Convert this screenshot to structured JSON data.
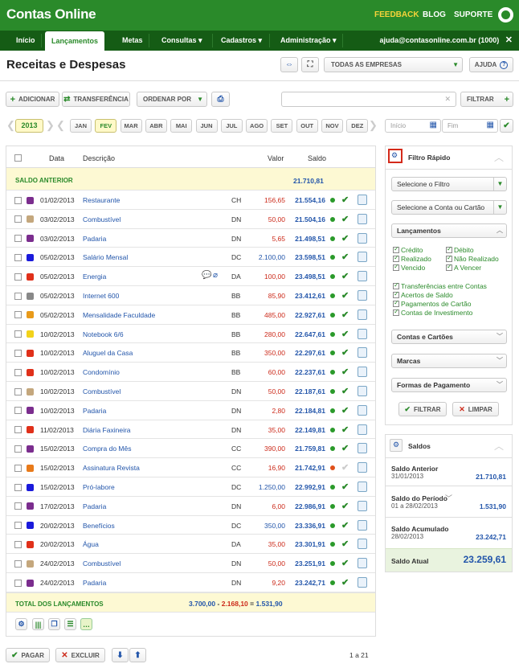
{
  "header": {
    "logo": "Contas Online",
    "links": [
      "FEEDBACK",
      "BLOG",
      "SUPORTE"
    ]
  },
  "nav": {
    "items": [
      "Início",
      "Lançamentos",
      "Metas",
      "Consultas ▾",
      "Cadastros ▾",
      "Administração ▾"
    ],
    "user": "ajuda@contasonline.com.br (1000)",
    "close": "✕"
  },
  "page": {
    "title": "Receitas e Despesas",
    "company_select": "TODAS AS EMPRESAS",
    "help": "AJUDA"
  },
  "toolbar": {
    "add": "ADICIONAR",
    "transfer": "TRANSFERÊNCIA",
    "order": "ORDENAR POR",
    "filter": "FILTRAR",
    "search_placeholder": ""
  },
  "months": {
    "year": "2013",
    "list": [
      "JAN",
      "FEV",
      "MAR",
      "ABR",
      "MAI",
      "JUN",
      "JUL",
      "AGO",
      "SET",
      "OUT",
      "NOV",
      "DEZ"
    ],
    "selected": "FEV",
    "start_placeholder": "Início",
    "end_placeholder": "Fim"
  },
  "table": {
    "headers": {
      "date": "Data",
      "desc": "Descrição",
      "value": "Valor",
      "balance": "Saldo"
    },
    "prev_balance_label": "SALDO ANTERIOR",
    "prev_balance": "21.710,81",
    "rows": [
      {
        "date": "01/02/2013",
        "desc": "Restaurante",
        "type": "CH",
        "value": "156,65",
        "balance": "21.554,16",
        "cat": "#7b2d8e",
        "kind": "exp",
        "status": "green",
        "ok": true
      },
      {
        "date": "03/02/2013",
        "desc": "Combustível",
        "type": "DN",
        "value": "50,00",
        "balance": "21.504,16",
        "cat": "#c4a77d",
        "kind": "exp",
        "status": "green",
        "ok": true
      },
      {
        "date": "03/02/2013",
        "desc": "Padaria",
        "type": "DN",
        "value": "5,65",
        "balance": "21.498,51",
        "cat": "#7b2d8e",
        "kind": "exp",
        "status": "green",
        "ok": true
      },
      {
        "date": "05/02/2013",
        "desc": "Salário Mensal",
        "type": "DC",
        "value": "2.100,00",
        "balance": "23.598,51",
        "cat": "#1a1adb",
        "kind": "inc",
        "status": "green",
        "ok": true
      },
      {
        "date": "05/02/2013",
        "desc": "Energia",
        "type": "DA",
        "value": "100,00",
        "balance": "23.498,51",
        "cat": "#e0301a",
        "kind": "exp",
        "status": "green",
        "ok": true,
        "extra": true
      },
      {
        "date": "05/02/2013",
        "desc": "Internet 600",
        "type": "BB",
        "value": "85,90",
        "balance": "23.412,61",
        "cat": "#888888",
        "kind": "exp",
        "status": "green",
        "ok": true
      },
      {
        "date": "05/02/2013",
        "desc": "Mensalidade Faculdade",
        "type": "BB",
        "value": "485,00",
        "balance": "22.927,61",
        "cat": "#e89a1a",
        "kind": "exp",
        "status": "green",
        "ok": true
      },
      {
        "date": "10/02/2013",
        "desc": "Notebook 6/6",
        "type": "BB",
        "value": "280,00",
        "balance": "22.647,61",
        "cat": "#f2d21a",
        "kind": "exp",
        "status": "green",
        "ok": true
      },
      {
        "date": "10/02/2013",
        "desc": "Aluguel da Casa",
        "type": "BB",
        "value": "350,00",
        "balance": "22.297,61",
        "cat": "#e0301a",
        "kind": "exp",
        "status": "green",
        "ok": true
      },
      {
        "date": "10/02/2013",
        "desc": "Condomínio",
        "type": "BB",
        "value": "60,00",
        "balance": "22.237,61",
        "cat": "#e0301a",
        "kind": "exp",
        "status": "green",
        "ok": true
      },
      {
        "date": "10/02/2013",
        "desc": "Combustível",
        "type": "DN",
        "value": "50,00",
        "balance": "22.187,61",
        "cat": "#c4a77d",
        "kind": "exp",
        "status": "green",
        "ok": true
      },
      {
        "date": "10/02/2013",
        "desc": "Padaria",
        "type": "DN",
        "value": "2,80",
        "balance": "22.184,81",
        "cat": "#7b2d8e",
        "kind": "exp",
        "status": "green",
        "ok": true
      },
      {
        "date": "11/02/2013",
        "desc": "Diária Faxineira",
        "type": "DN",
        "value": "35,00",
        "balance": "22.149,81",
        "cat": "#e0301a",
        "kind": "exp",
        "status": "green",
        "ok": true
      },
      {
        "date": "15/02/2013",
        "desc": "Compra do Mês",
        "type": "CC",
        "value": "390,00",
        "balance": "21.759,81",
        "cat": "#7b2d8e",
        "kind": "exp",
        "status": "green",
        "ok": true
      },
      {
        "date": "15/02/2013",
        "desc": "Assinatura Revista",
        "type": "CC",
        "value": "16,90",
        "balance": "21.742,91",
        "cat": "#e87a1a",
        "kind": "exp",
        "status": "red",
        "ok": false
      },
      {
        "date": "15/02/2013",
        "desc": "Pró-labore",
        "type": "DC",
        "value": "1.250,00",
        "balance": "22.992,91",
        "cat": "#1a1adb",
        "kind": "inc",
        "status": "green",
        "ok": true
      },
      {
        "date": "17/02/2013",
        "desc": "Padaria",
        "type": "DN",
        "value": "6,00",
        "balance": "22.986,91",
        "cat": "#7b2d8e",
        "kind": "exp",
        "status": "green",
        "ok": true
      },
      {
        "date": "20/02/2013",
        "desc": "Benefícios",
        "type": "DC",
        "value": "350,00",
        "balance": "23.336,91",
        "cat": "#1a1adb",
        "kind": "inc",
        "status": "green",
        "ok": true
      },
      {
        "date": "20/02/2013",
        "desc": "Água",
        "type": "DA",
        "value": "35,00",
        "balance": "23.301,91",
        "cat": "#e0301a",
        "kind": "exp",
        "status": "green",
        "ok": true
      },
      {
        "date": "24/02/2013",
        "desc": "Combustível",
        "type": "DN",
        "value": "50,00",
        "balance": "23.251,91",
        "cat": "#c4a77d",
        "kind": "exp",
        "status": "green",
        "ok": true
      },
      {
        "date": "24/02/2013",
        "desc": "Padaria",
        "type": "DN",
        "value": "9,20",
        "balance": "23.242,71",
        "cat": "#7b2d8e",
        "kind": "exp",
        "status": "green",
        "ok": true
      }
    ],
    "total_label": "TOTAL DOS LANÇAMENTOS",
    "total_income": "3.700,00",
    "total_sep1": "-",
    "total_expense": "2.168,10",
    "total_sep2": "=",
    "total_result": "1.531,90"
  },
  "bottom": {
    "pay": "PAGAR",
    "delete": "EXCLUIR",
    "pagination": "1 a 21"
  },
  "filter": {
    "title": "Filtro Rápido",
    "select_filter": "Selecione o Filtro",
    "select_account": "Selecione a Conta ou Cartão",
    "section": "Lançamentos",
    "checks_left": [
      "Crédito",
      "Realizado",
      "Vencido"
    ],
    "checks_right": [
      "Débito",
      "Não Realizado",
      "A Vencer"
    ],
    "checks_full": [
      "Transferências entre Contas",
      "Acertos de Saldo",
      "Pagamentos de Cartão",
      "Contas de Investimento"
    ],
    "collapsed": [
      "Contas e Cartões",
      "Marcas",
      "Formas de Pagamento"
    ],
    "apply": "FILTRAR",
    "clear": "LIMPAR"
  },
  "saldos": {
    "title": "Saldos",
    "prev_label": "Saldo Anterior",
    "prev_date": "31/01/2013",
    "prev_value": "21.710,81",
    "period_label": "Saldo do Período",
    "period_date": "01 a 28/02/2013",
    "period_value": "1.531,90",
    "acc_label": "Saldo Acumulado",
    "acc_date": "28/02/2013",
    "acc_value": "23.242,71",
    "current_label": "Saldo Atual",
    "current_value": "23.259,61"
  }
}
